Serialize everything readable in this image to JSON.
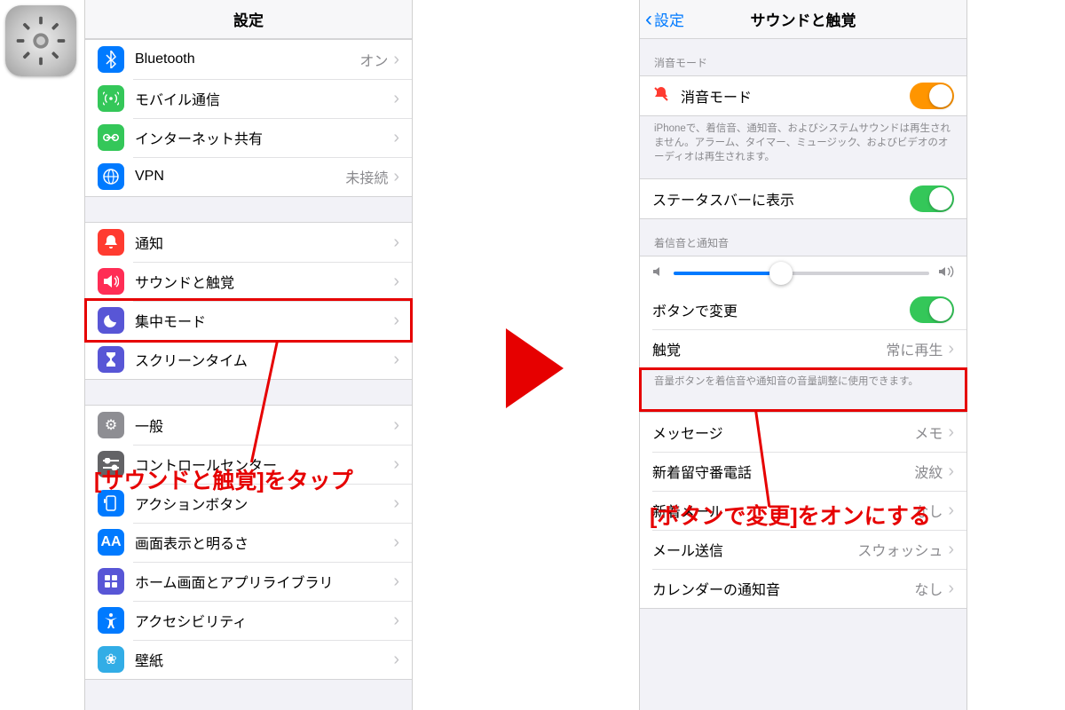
{
  "app_icon": "settings-gear-icon",
  "left": {
    "title": "設定",
    "g1": [
      {
        "label": "Bluetooth",
        "value": "オン",
        "icon": "bluetooth-icon",
        "color": "ic-blue"
      },
      {
        "label": "モバイル通信",
        "value": "",
        "icon": "antenna-icon",
        "color": "ic-green"
      },
      {
        "label": "インターネット共有",
        "value": "",
        "icon": "link-icon",
        "color": "ic-green"
      },
      {
        "label": "VPN",
        "value": "未接続",
        "icon": "vpn-icon",
        "color": "ic-blue"
      }
    ],
    "g2": [
      {
        "label": "通知",
        "icon": "bell-icon",
        "color": "ic-red"
      },
      {
        "label": "サウンドと触覚",
        "icon": "speaker-icon",
        "color": "ic-pink"
      },
      {
        "label": "集中モード",
        "icon": "moon-icon",
        "color": "ic-indigo"
      },
      {
        "label": "スクリーンタイム",
        "icon": "hourglass-icon",
        "color": "ic-indigo"
      }
    ],
    "g3": [
      {
        "label": "一般",
        "icon": "gear-icon",
        "color": "ic-gray"
      },
      {
        "label": "コントロールセンター",
        "icon": "switches-icon",
        "color": "ic-gray2"
      },
      {
        "label": "アクションボタン",
        "icon": "action-icon",
        "color": "ic-blue"
      },
      {
        "label": "画面表示と明るさ",
        "icon": "text-size-icon",
        "color": "ic-blue"
      },
      {
        "label": "ホーム画面とアプリライブラリ",
        "icon": "grid-icon",
        "color": "ic-indigo"
      },
      {
        "label": "アクセシビリティ",
        "icon": "accessibility-icon",
        "color": "ic-blue"
      },
      {
        "label": "壁紙",
        "icon": "flower-icon",
        "color": "ic-cyan"
      }
    ]
  },
  "right": {
    "back": "設定",
    "title": "サウンドと触覚",
    "section_silent": "消音モード",
    "silent_label": "消音モード",
    "silent_footer": "iPhoneで、着信音、通知音、およびシステムサウンドは再生されません。アラーム、タイマー、ミュージック、およびビデオのオーディオは再生されます。",
    "statusbar_label": "ステータスバーに表示",
    "section_ringer": "着信音と通知音",
    "slider_percent": 42,
    "button_change_label": "ボタンで変更",
    "haptics_label": "触覚",
    "haptics_value": "常に再生",
    "ringer_footer": "音量ボタンを着信音や通知音の音量調整に使用できます。",
    "g_sounds": [
      {
        "label": "メッセージ",
        "value": "メモ"
      },
      {
        "label": "新着留守番電話",
        "value": "波紋"
      },
      {
        "label": "新着メール",
        "value": "なし"
      },
      {
        "label": "メール送信",
        "value": "スウォッシュ"
      },
      {
        "label": "カレンダーの通知音",
        "value": "なし"
      }
    ]
  },
  "annotation_left": "[サウンドと触覚]をタップ",
  "annotation_right": "[ボタンで変更]をオンにする"
}
